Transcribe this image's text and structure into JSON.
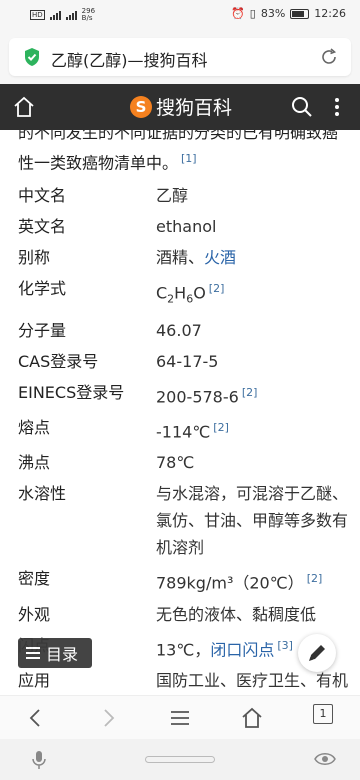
{
  "status_bar": {
    "net_speed_top": "296",
    "net_speed_unit": "B/s",
    "battery": "83%",
    "time": "12:26"
  },
  "url_bar": {
    "title": "乙醇(乙醇)—搜狗百科"
  },
  "header": {
    "logo_mark": "S",
    "logo_text": "搜狗百科"
  },
  "intro": {
    "text_line1": "的不同发生的不同证据的分类的已有明确致癌性一类致癌物清单中。",
    "ref": "[1]"
  },
  "info_rows": [
    {
      "key": "中文名",
      "value": "乙醇"
    },
    {
      "key": "英文名",
      "value": "ethanol"
    },
    {
      "key": "别称",
      "value": "酒精、",
      "link": "火酒"
    },
    {
      "key": "化学式",
      "value": "C",
      "sub1": "2",
      "mid": "H",
      "sub2": "6",
      "end": "O",
      "ref": "[2]"
    },
    {
      "key": "分子量",
      "value": "46.07"
    },
    {
      "key": "CAS登录号",
      "value": "64-17-5"
    },
    {
      "key": "EINECS登录号",
      "value": "200-578-6",
      "ref": "[2]"
    },
    {
      "key": "熔点",
      "value": "-114℃",
      "ref": "[2]"
    },
    {
      "key": "沸点",
      "value": "78℃"
    },
    {
      "key": "水溶性",
      "value": "与水混溶，可混溶于乙醚、氯仿、甘油、甲醇等多数有机溶剂"
    },
    {
      "key": "密度",
      "value": "789kg/m³（20℃）",
      "ref": "[2]"
    },
    {
      "key": "外观",
      "value": "无色的液体、黏稠度低"
    },
    {
      "key": "闪点",
      "value": "13℃，",
      "link": "闭口闪点",
      "ref": "[3]"
    },
    {
      "key": "应用",
      "value": "国防工业、医疗卫生、有机合成、食品工业、工农业生产"
    }
  ],
  "toc_button": {
    "label": "目录"
  },
  "bottom_nav": {
    "tab_count": "1"
  }
}
